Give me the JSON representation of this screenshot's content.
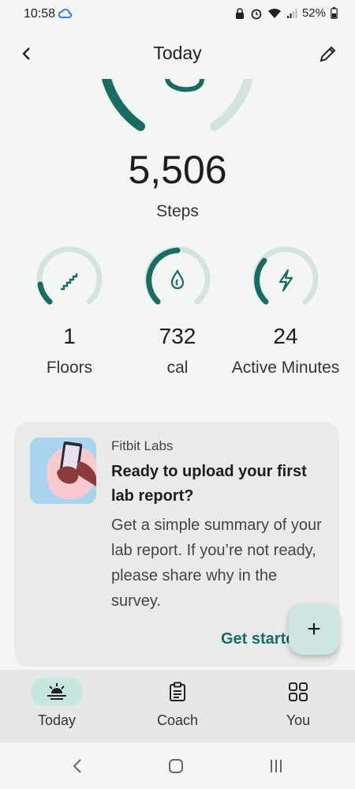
{
  "status": {
    "time": "10:58",
    "battery": "52%"
  },
  "header": {
    "title": "Today"
  },
  "steps": {
    "value": "5,506",
    "label": "Steps",
    "progress": 0.72
  },
  "metrics": [
    {
      "value": "1",
      "label": "Floors",
      "icon": "stairs-icon",
      "progress": 0.3
    },
    {
      "value": "732",
      "label": "cal",
      "icon": "flame-icon",
      "progress": 0.55
    },
    {
      "value": "24",
      "label": "Active Minutes",
      "icon": "bolt-icon",
      "progress": 0.35
    }
  ],
  "card": {
    "eyebrow": "Fitbit Labs",
    "title": "Ready to upload your first lab report?",
    "body": "Get a simple summary of your lab report. If you’re not ready, please share why in the survey.",
    "cta": "Get started"
  },
  "fab": {
    "label": "+"
  },
  "nav": {
    "items": [
      {
        "label": "Today"
      },
      {
        "label": "Coach"
      },
      {
        "label": "You"
      }
    ]
  },
  "colors": {
    "accent": "#176d63",
    "track": "#d5e3df",
    "activePill": "#c8e6e0"
  }
}
